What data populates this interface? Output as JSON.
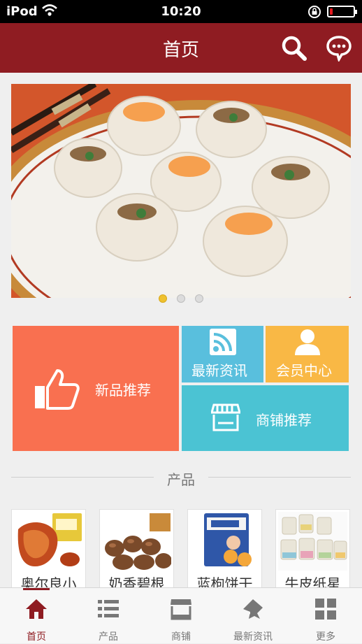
{
  "status_bar": {
    "carrier": "iPod",
    "time": "10:20",
    "battery_level": 0.12,
    "battery_color": "#e3181e"
  },
  "header": {
    "title": "首页",
    "icons": [
      "search-icon",
      "chat-icon"
    ]
  },
  "banner": {
    "slide_count": 3,
    "active_slide": 1
  },
  "tiles": {
    "new_products": {
      "label": "新品推荐",
      "icon": "thumbs-up-icon",
      "color": "#f97050"
    },
    "news": {
      "label": "最新资讯",
      "icon": "rss-icon",
      "color": "#59bfdd"
    },
    "member": {
      "label": "会员中心",
      "icon": "user-icon",
      "color": "#f9b845"
    },
    "store": {
      "label": "商铺推荐",
      "icon": "store-icon",
      "color": "#4bc3d3"
    }
  },
  "products_section": {
    "title": "产品",
    "items": [
      {
        "name": "奥尔良小"
      },
      {
        "name": "奶香碧根"
      },
      {
        "name": "蓝枸饼干"
      },
      {
        "name": "牛皮纸星"
      }
    ]
  },
  "tab_bar": {
    "active_tab": 0,
    "accent_color": "#8f1c22",
    "tabs": [
      {
        "label": "首页",
        "icon": "home-icon"
      },
      {
        "label": "产品",
        "icon": "list-icon"
      },
      {
        "label": "商铺",
        "icon": "store-icon"
      },
      {
        "label": "最新资讯",
        "icon": "news-icon"
      },
      {
        "label": "更多",
        "icon": "grid-icon"
      }
    ]
  }
}
